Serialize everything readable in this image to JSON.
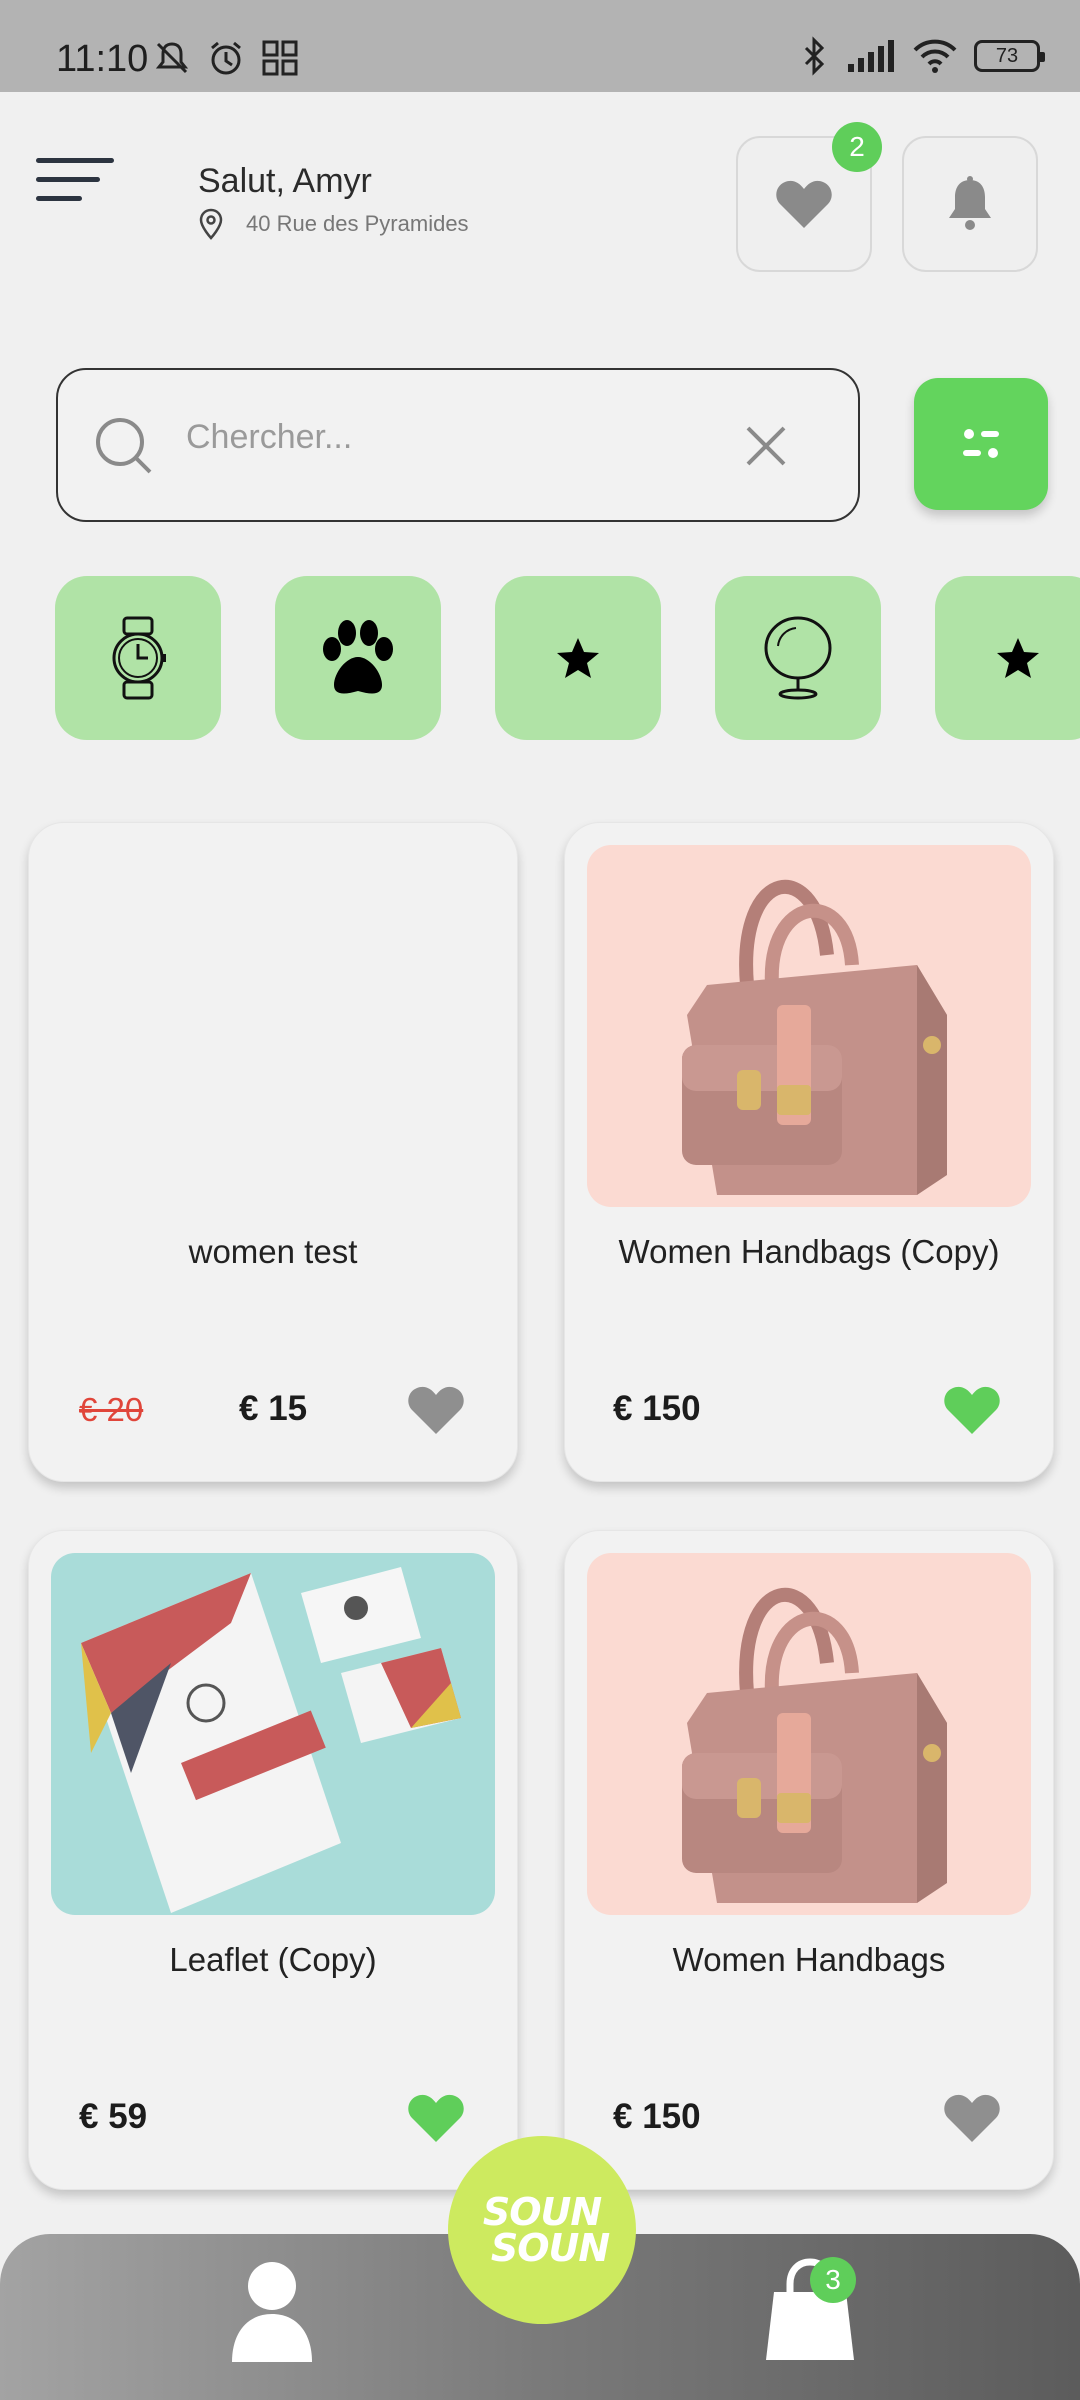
{
  "status_bar": {
    "time": "11:10",
    "battery": "73"
  },
  "header": {
    "greeting": "Salut, Amyr",
    "location": "40 Rue des Pyramides",
    "favorites_count": "2"
  },
  "search": {
    "placeholder": "Chercher..."
  },
  "categories": [
    {
      "icon": "watch-icon"
    },
    {
      "icon": "paw-icon"
    },
    {
      "icon": "star-icon"
    },
    {
      "icon": "mirror-icon"
    },
    {
      "icon": "star-icon"
    }
  ],
  "products": [
    {
      "title": "women test",
      "old_price": "€ 20",
      "price": "€ 15",
      "favorite": false,
      "image": "none"
    },
    {
      "title": "Women Handbags (Copy)",
      "price": "€ 150",
      "favorite": true,
      "image": "handbag"
    },
    {
      "title": "Leaflet (Copy)",
      "price": "€ 59",
      "favorite": true,
      "image": "leaflet"
    },
    {
      "title": "Women Handbags",
      "price": "€ 150",
      "favorite": false,
      "image": "handbag"
    }
  ],
  "bottom_nav": {
    "logo_line1": "SOUN",
    "logo_line2": "SOUN",
    "cart_count": "3"
  },
  "colors": {
    "accent_green": "#63d45d",
    "category_green": "#b0e3a6",
    "price_strike_red": "#e0453a",
    "logo_lime": "#cdea5f"
  }
}
